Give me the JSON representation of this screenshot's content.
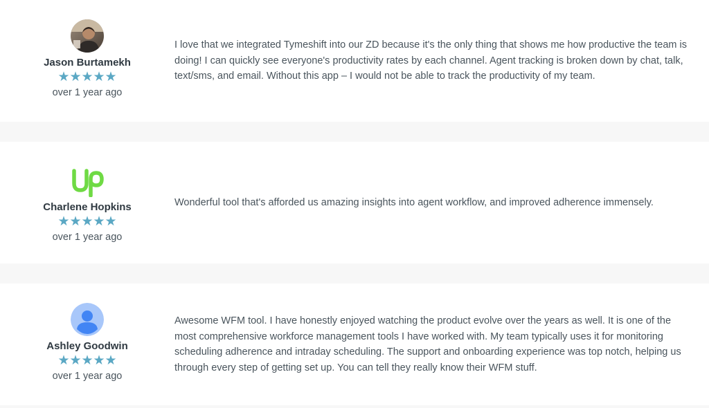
{
  "reviews": [
    {
      "reviewer": "Jason Burtamekh",
      "avatar_icon": "person-photo-icon",
      "rating": 5,
      "stars": "★★★★★",
      "date": "over 1 year ago",
      "text": "I love that we integrated Tymeshift into our ZD because it's the only thing that shows me how productive the team is doing! I can quickly see everyone's productivity rates by each channel. Agent tracking is broken down by chat, talk, text/sms, and email. Without this app – I would not be able to track the productivity of my team."
    },
    {
      "reviewer": "Charlene Hopkins",
      "avatar_icon": "upwork-logo-icon",
      "avatar_logo_text": "Up",
      "rating": 5,
      "stars": "★★★★★",
      "date": "over 1 year ago",
      "text": "Wonderful tool that's afforded us amazing insights into agent workflow, and improved adherence immensely."
    },
    {
      "reviewer": "Ashley Goodwin",
      "avatar_icon": "default-user-icon",
      "rating": 5,
      "stars": "★★★★★",
      "date": "over 1 year ago",
      "text": "Awesome WFM tool. I have honestly enjoyed watching the product evolve over the years as well. It is one of the most comprehensive workforce management tools I have worked with. My team typically uses it for monitoring scheduling adherence and intraday scheduling. The support and onboarding experience was top notch, helping us through every step of getting set up. You can tell they really know their WFM stuff."
    }
  ],
  "colors": {
    "star": "#5ba8c4",
    "background": "#f7f7f7",
    "card": "#ffffff",
    "upwork_green": "#6fda44",
    "default_avatar_bg": "#a8c7fa",
    "default_avatar_fg": "#4285f4"
  }
}
